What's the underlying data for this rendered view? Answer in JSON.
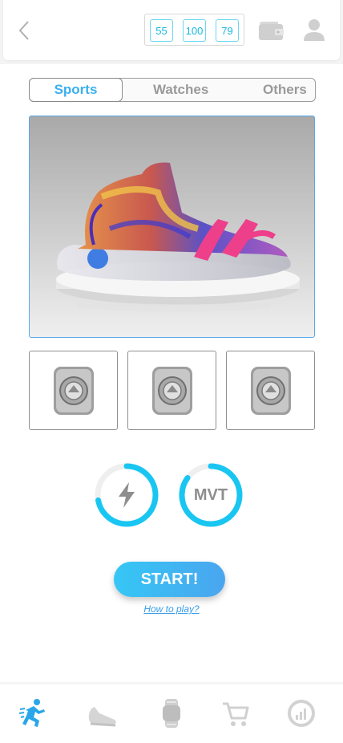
{
  "header": {
    "back_icon": "chevron-left-icon",
    "counters": [
      "55",
      "100",
      "79"
    ],
    "wallet_icon": "wallet-icon",
    "profile_icon": "user-icon"
  },
  "tabs": [
    {
      "label": "Sports",
      "active": true
    },
    {
      "label": "Watches",
      "active": false
    },
    {
      "label": "Others",
      "active": false
    }
  ],
  "hero": {
    "icon": "sneaker-image"
  },
  "thumbnails": [
    {
      "icon": "gem-badge-icon"
    },
    {
      "icon": "gem-badge-icon"
    },
    {
      "icon": "gem-badge-icon"
    }
  ],
  "gauges": [
    {
      "icon": "lightning-icon",
      "label": "",
      "level": 0.72
    },
    {
      "icon": "",
      "label": "MVT",
      "level": 0.85
    }
  ],
  "start_label": "START!",
  "how_to_label": "How to play?",
  "bottom_nav": [
    {
      "icon": "runner-icon",
      "active": true
    },
    {
      "icon": "sneaker-icon",
      "active": false
    },
    {
      "icon": "watch-icon",
      "active": false
    },
    {
      "icon": "cart-icon",
      "active": false
    },
    {
      "icon": "stats-icon",
      "active": false
    }
  ],
  "colors": {
    "accent": "#3ab0ef",
    "accent_light": "#35c7f5",
    "inactive": "#c8c8c8"
  }
}
